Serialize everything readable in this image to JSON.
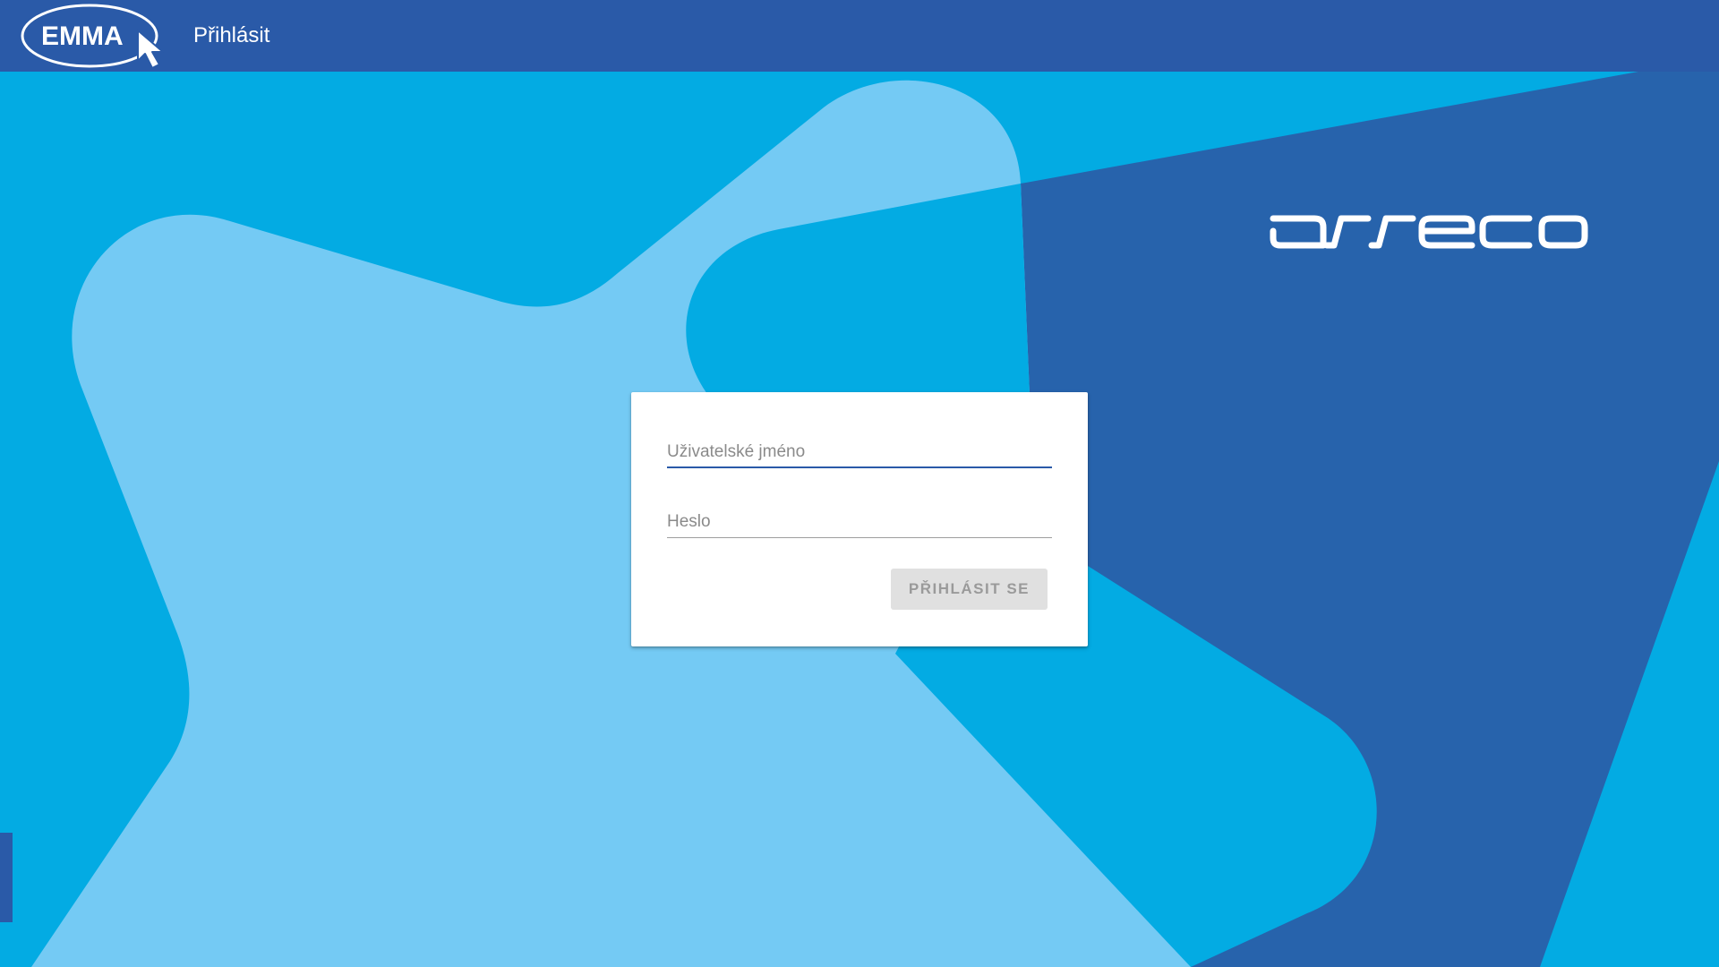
{
  "header": {
    "logo_text": "EMMA",
    "title": "Přihlásit"
  },
  "brand": {
    "logo_text": "asseco"
  },
  "login": {
    "username_placeholder": "Uživatelské jméno",
    "username_value": "",
    "password_placeholder": "Heslo",
    "password_value": "",
    "submit_label": "PŘIHLÁSIT SE",
    "submit_enabled": false
  },
  "colors": {
    "header": "#2a5aa8",
    "background_cyan": "#03abe3",
    "background_light": "#74caf4",
    "background_dark": "#2763ac",
    "card": "#ffffff",
    "button_disabled": "#e0e0e0"
  },
  "icons": {
    "logo_cursor": "cursor-arrow-icon"
  }
}
